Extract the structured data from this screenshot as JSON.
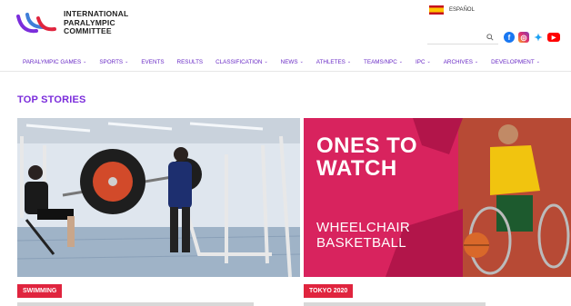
{
  "header": {
    "logo_lines": [
      "INTERNATIONAL",
      "PARALYMPIC",
      "COMMITTEE"
    ],
    "language": "ESPAÑOL"
  },
  "nav": [
    {
      "label": "PARALYMPIC GAMES",
      "dropdown": true
    },
    {
      "label": "SPORTS",
      "dropdown": true
    },
    {
      "label": "EVENTS",
      "dropdown": false
    },
    {
      "label": "RESULTS",
      "dropdown": false
    },
    {
      "label": "CLASSIFICATION",
      "dropdown": true
    },
    {
      "label": "NEWS",
      "dropdown": true
    },
    {
      "label": "ATHLETES",
      "dropdown": true
    },
    {
      "label": "TEAMS/NPC",
      "dropdown": true
    },
    {
      "label": "IPC",
      "dropdown": true
    },
    {
      "label": "ARCHIVES",
      "dropdown": true
    },
    {
      "label": "DEVELOPMENT",
      "dropdown": true
    }
  ],
  "section_title": "TOP STORIES",
  "stories": [
    {
      "tag": "SWIMMING"
    },
    {
      "tag": "TOKYO 2020",
      "promo_title_lines": [
        "ONES TO",
        "WATCH"
      ],
      "promo_subtitle_lines": [
        "WHEELCHAIR",
        "BASKETBALL"
      ]
    }
  ],
  "colors": {
    "accent": "#7b2ddb",
    "tag_bg": "#e0243e",
    "promo_bg": "#d8235e"
  }
}
